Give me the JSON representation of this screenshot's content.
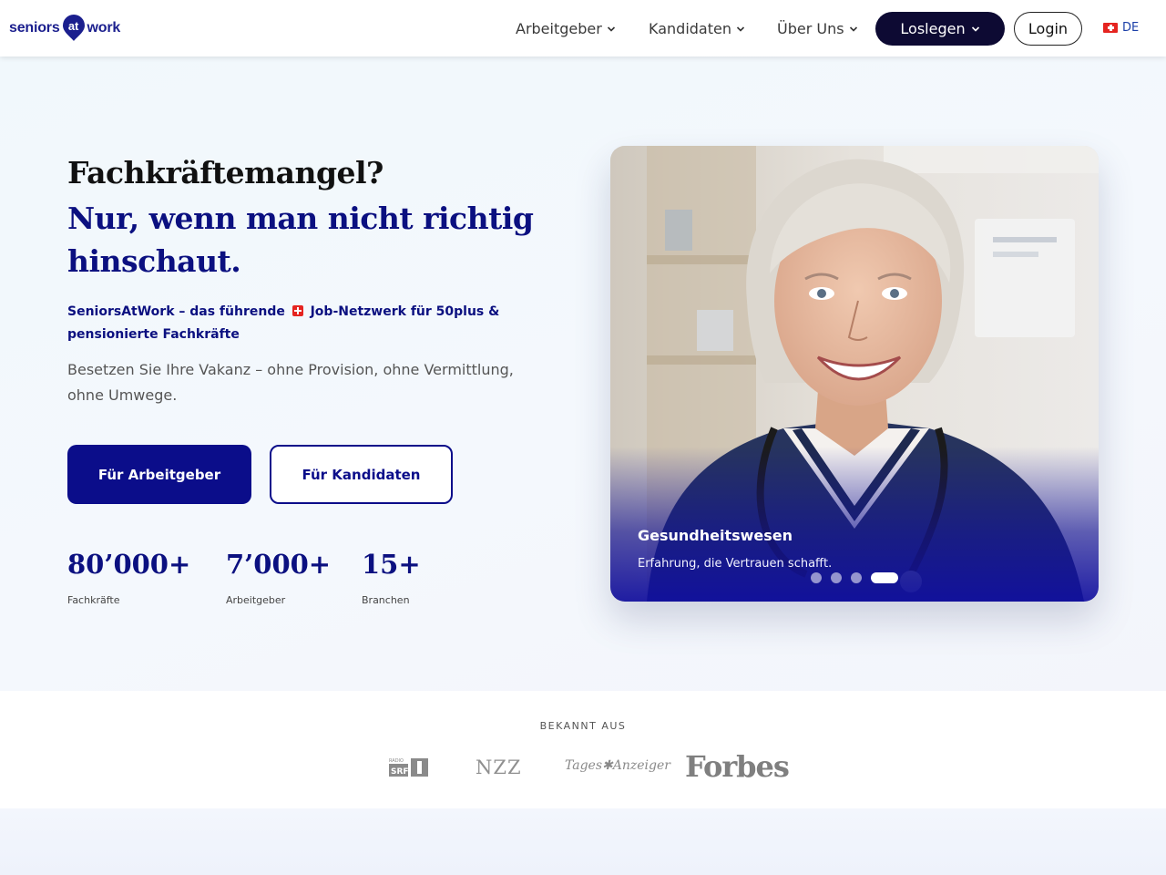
{
  "nav": {
    "logo_left": "seniors",
    "logo_mid": "at",
    "logo_right": "work",
    "items": [
      {
        "label": "Arbeitgeber"
      },
      {
        "label": "Kandidaten"
      },
      {
        "label": "Über Uns"
      }
    ],
    "cta_label": "Loslegen",
    "login_label": "Login",
    "lang_label": "DE"
  },
  "hero": {
    "title_line1": "Fachkräftemangel?",
    "title_line2": "Nur, wenn man nicht richtig hinschaut.",
    "sub_part1": "SeniorsAtWork – das führende",
    "sub_part2": "Job-Netzwerk für 50plus & pensionierte Fachkräfte",
    "description": "Besetzen Sie Ihre Vakanz – ohne Provision, ohne Vermittlung, ohne Umwege.",
    "btn_primary": "Für Arbeitgeber",
    "btn_secondary": "Für Kandidaten",
    "stats": [
      {
        "value": "80’000+",
        "label": "Fachkräfte"
      },
      {
        "value": "7’000+",
        "label": "Arbeitgeber"
      },
      {
        "value": "15+",
        "label": "Branchen"
      }
    ]
  },
  "carousel": {
    "title": "Gesundheitswesen",
    "subtitle": "Erfahrung, die Vertrauen schafft.",
    "slide_count": 4,
    "active_index": 3
  },
  "press": {
    "label": "BEKANNT AUS",
    "logos": [
      {
        "name": "srf",
        "text_top": "RADIO",
        "text_box": "SRF",
        "text_num": "1"
      },
      {
        "name": "nzz",
        "text": "NZZ"
      },
      {
        "name": "tages-anzeiger",
        "text": "Tages✱Anzeiger"
      },
      {
        "name": "forbes",
        "text": "Forbes"
      }
    ]
  },
  "colors": {
    "brand_navy": "#0b0d8a",
    "dark_button": "#0d0a33",
    "swiss_red": "#e52420"
  }
}
